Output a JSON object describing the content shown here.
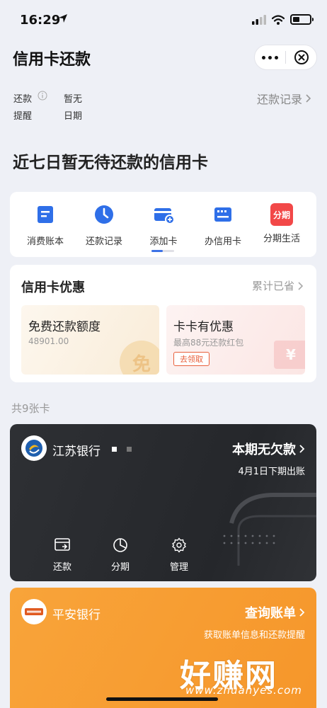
{
  "status_bar": {
    "time": "16:29"
  },
  "nav": {
    "title": "信用卡还款"
  },
  "reminder": {
    "label_line1": "还款",
    "label_line2": "提醒",
    "value_line1": "暂无",
    "value_line2": "日期",
    "record_link": "还款记录"
  },
  "headline": "近七日暂无待还款的信用卡",
  "quick_actions": [
    {
      "label": "消费账本",
      "icon": "bill-book-icon"
    },
    {
      "label": "还款记录",
      "icon": "clock-icon"
    },
    {
      "label": "添加卡",
      "icon": "add-card-icon"
    },
    {
      "label": "办信用卡",
      "icon": "credit-card-icon"
    },
    {
      "label": "分期生活",
      "icon": "installment-icon",
      "badge": "分期"
    }
  ],
  "offers": {
    "title": "信用卡优惠",
    "more": "累计已省",
    "items": [
      {
        "title": "免费还款额度",
        "sub": "48901.00",
        "deco": "免"
      },
      {
        "title": "卡卡有优惠",
        "sub": "最高88元还款红包",
        "button": "去领取",
        "deco": "¥"
      }
    ]
  },
  "card_count": "共9张卡",
  "cards": [
    {
      "bank": "江苏银行",
      "status": "本期无欠款",
      "substatus": "4月1日下期出账",
      "actions": [
        {
          "label": "还款",
          "icon": "repay-icon"
        },
        {
          "label": "分期",
          "icon": "pie-chart-icon"
        },
        {
          "label": "管理",
          "icon": "gear-icon"
        }
      ]
    },
    {
      "bank": "平安银行",
      "status": "查询账单",
      "substatus": "获取账单信息和还款提醒"
    }
  ],
  "watermark": {
    "text": "好赚网",
    "url": "www.zhuanyes.com"
  },
  "colors": {
    "accent": "#3d72e6",
    "dark_card": "#2b2d31",
    "orange_card": "#f79d33",
    "coupon_red": "#e8603c"
  }
}
